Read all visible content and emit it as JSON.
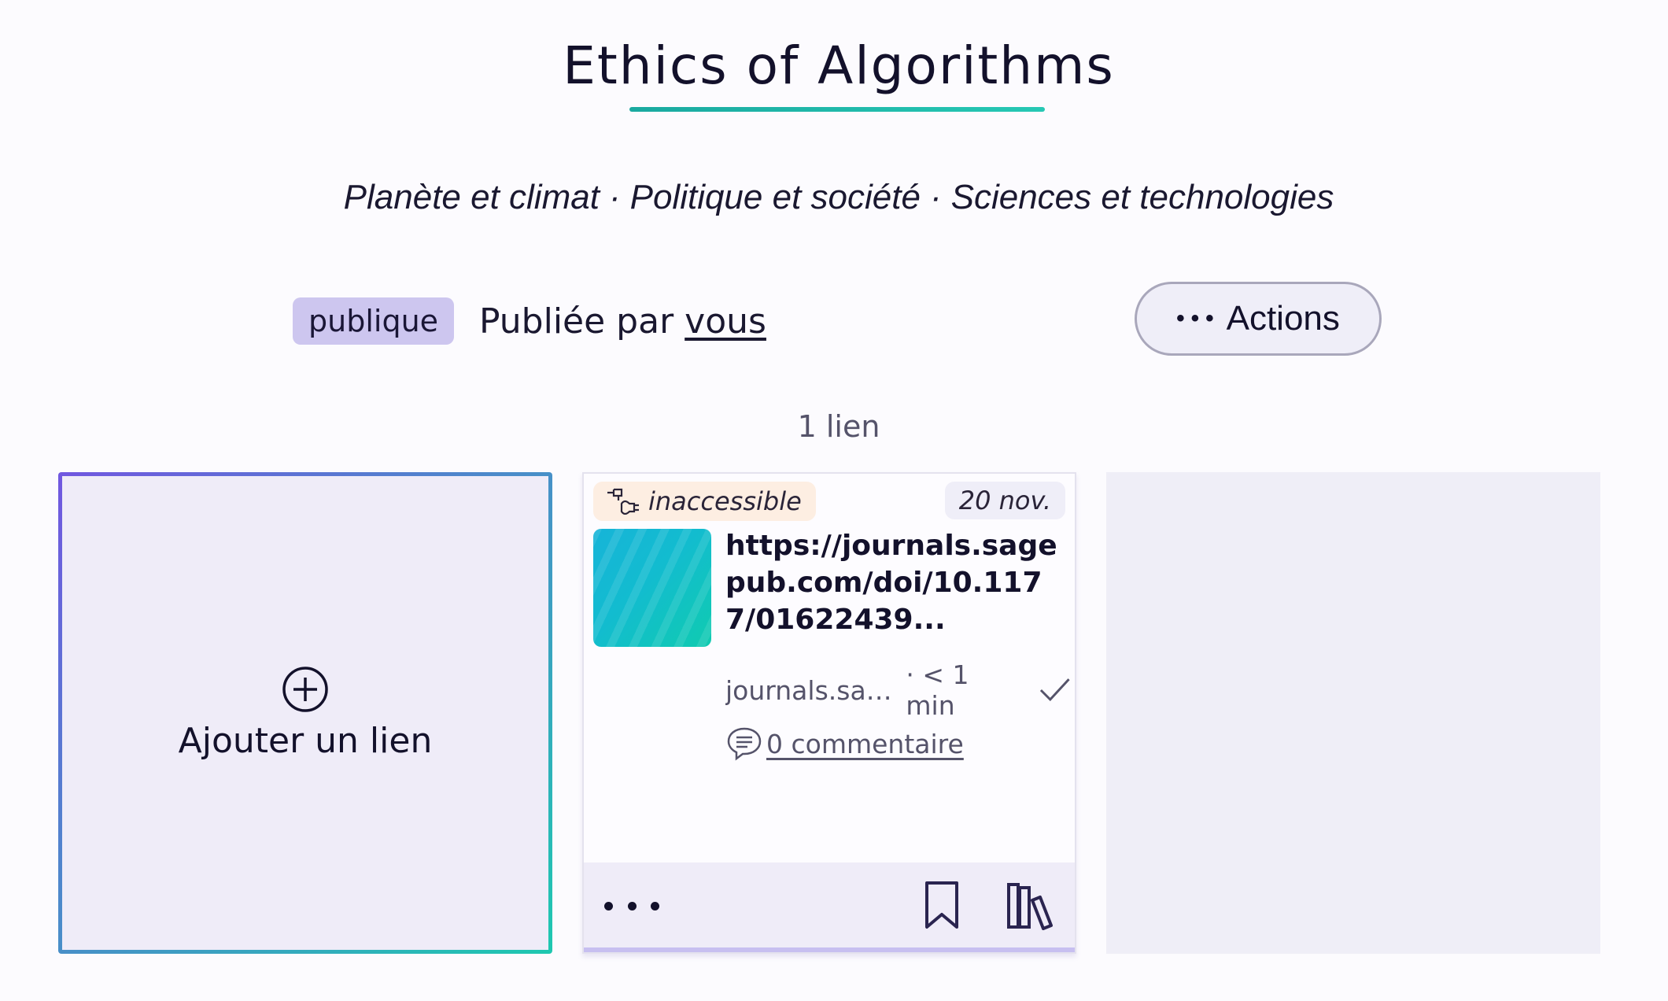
{
  "collection": {
    "title": "Ethics of Algorithms",
    "topics": [
      "Planète et climat",
      "Politique et société",
      "Sciences et technologies"
    ],
    "topic_separator": "·",
    "visibility_badge": "publique",
    "published_prefix": "Publiée par",
    "published_by": "vous",
    "actions_label": "Actions",
    "link_count": "1 lien"
  },
  "add_card": {
    "label": "Ajouter un lien",
    "icon": "plus-circle-icon"
  },
  "link_card": {
    "status": "inaccessible",
    "status_icon": "unplugged-icon",
    "date": "20 nov.",
    "title": "https://journals.sagepub.com/doi/10.1177/01622439...",
    "domain": "journals.sag...",
    "reading_time": "· < 1 min",
    "comments": "0 commentaire",
    "icons": [
      "check-icon",
      "comment-icon",
      "more-icon",
      "bookmark-icon",
      "library-icon"
    ]
  },
  "colors": {
    "accent": "#1ec8b0",
    "badge_public": "#cdc6ef",
    "status_bg": "#fdeee2",
    "card_bg": "#efecf8"
  }
}
